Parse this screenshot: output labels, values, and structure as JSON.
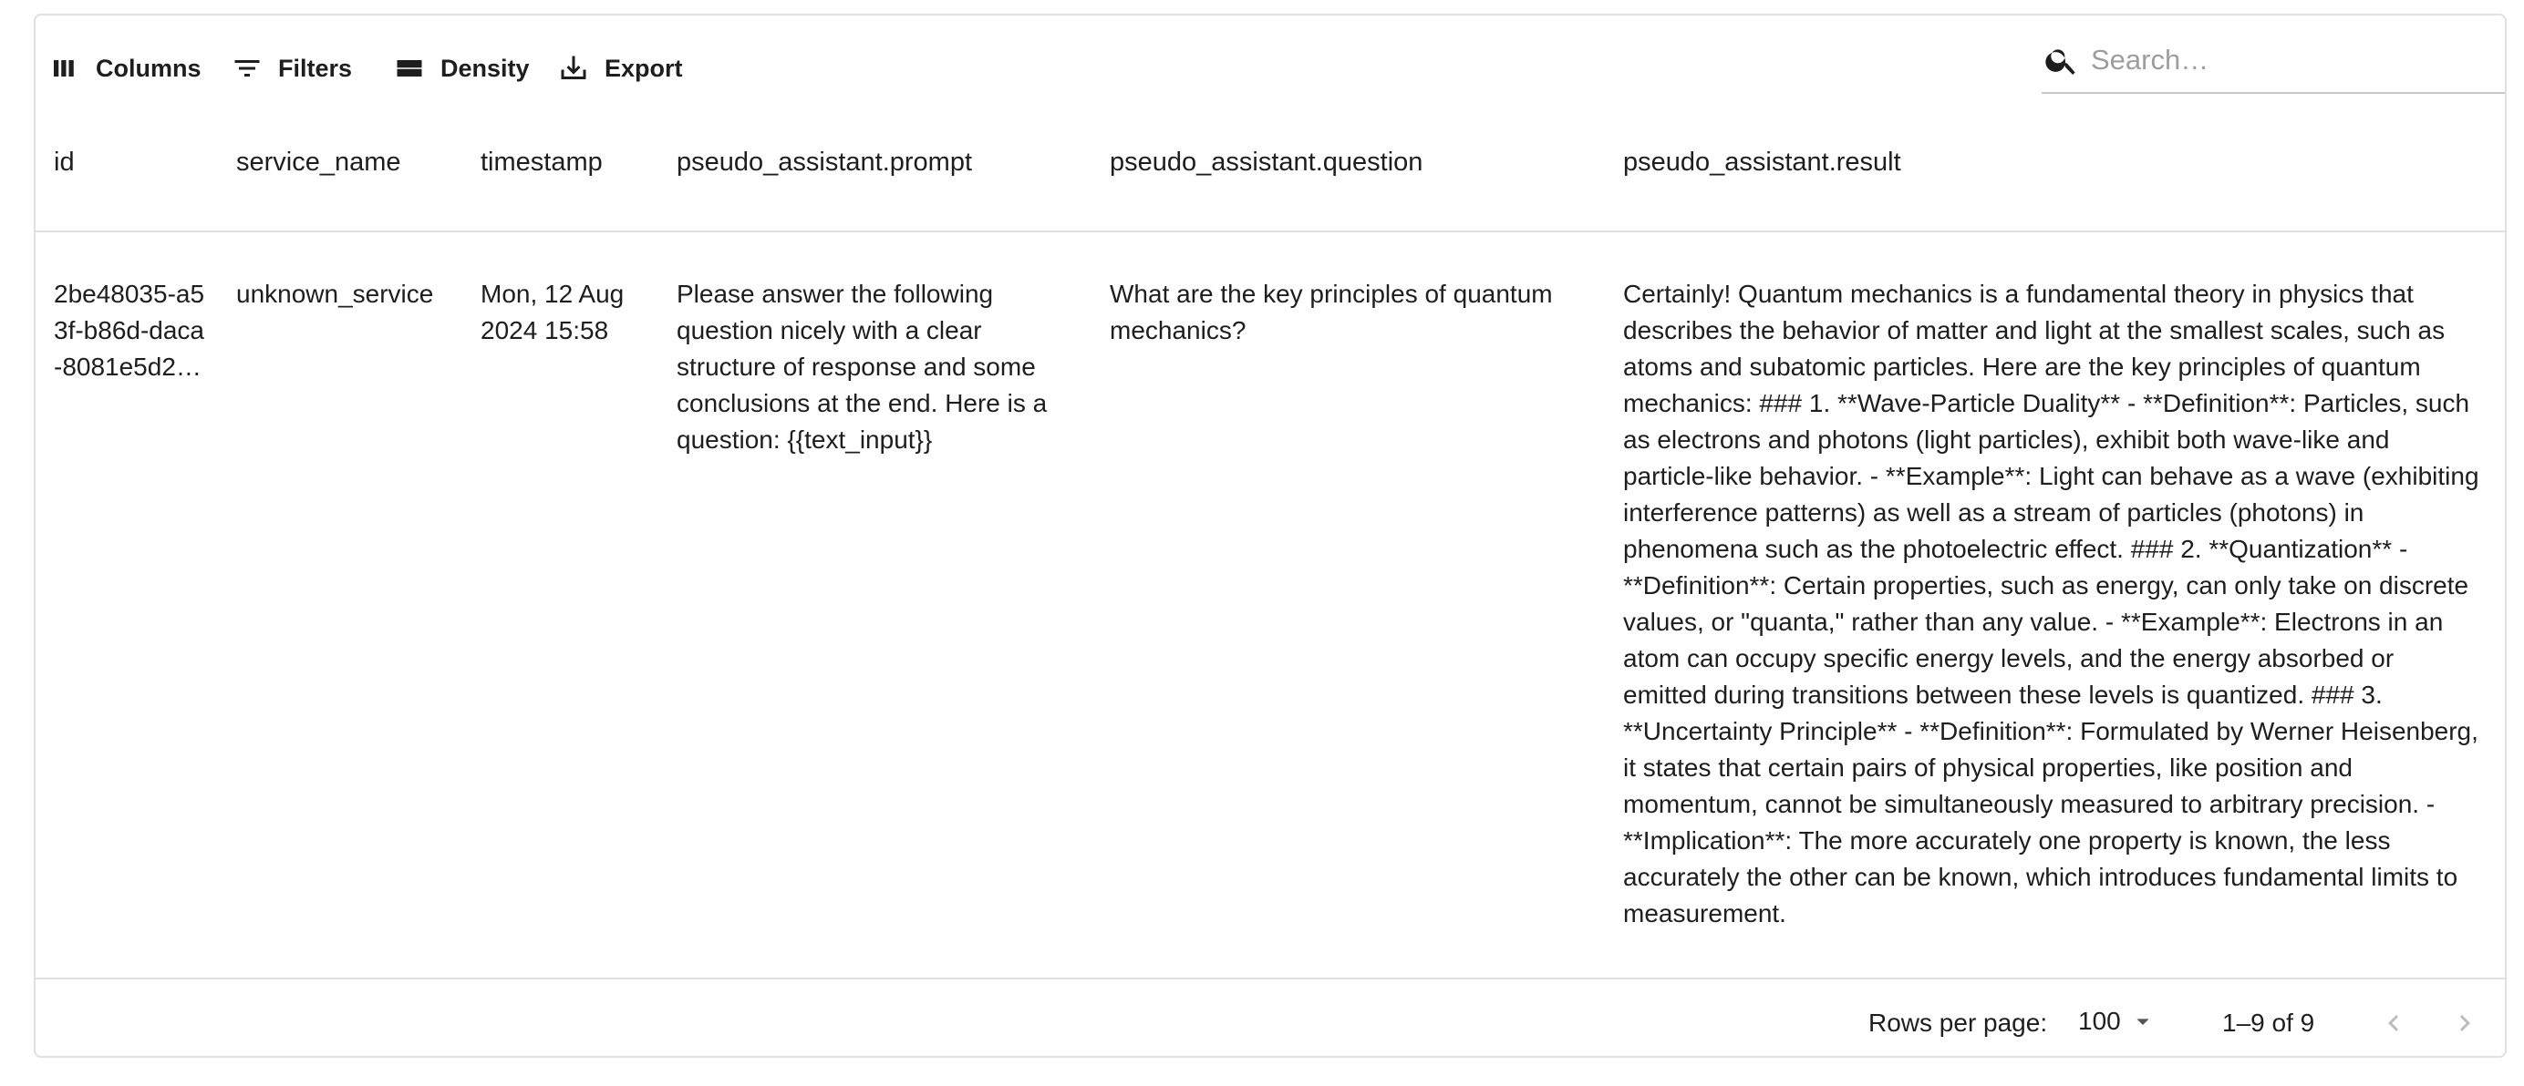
{
  "toolbar": {
    "columns_label": "Columns",
    "filters_label": "Filters",
    "density_label": "Density",
    "export_label": "Export",
    "search_placeholder": "Search…"
  },
  "columns": [
    "id",
    "service_name",
    "timestamp",
    "pseudo_assistant.prompt",
    "pseudo_assistant.question",
    "pseudo_assistant.result"
  ],
  "rows": [
    {
      "id": "2be48035-a53f-b86d-daca-8081e5d2…",
      "service_name": "unknown_service",
      "timestamp": "Mon, 12 Aug 2024 15:58",
      "prompt": "Please answer the following question nicely with a clear structure of response and some conclusions at the end. Here is a question: {{text_input}}",
      "question": "What are the key principles of quantum mechanics?",
      "result": "Certainly! Quantum mechanics is a fundamental theory in physics that describes the behavior of matter and light at the smallest scales, such as atoms and subatomic particles. Here are the key principles of quantum mechanics: ### 1. **Wave-Particle Duality** - **Definition**: Particles, such as electrons and photons (light particles), exhibit both wave-like and particle-like behavior. - **Example**: Light can behave as a wave (exhibiting interference patterns) as well as a stream of particles (photons) in phenomena such as the photoelectric effect. ### 2. **Quantization** - **Definition**: Certain properties, such as energy, can only take on discrete values, or \"quanta,\" rather than any value. - **Example**: Electrons in an atom can occupy specific energy levels, and the energy absorbed or emitted during transitions between these levels is quantized. ### 3. **Uncertainty Principle** - **Definition**: Formulated by Werner Heisenberg, it states that certain pairs of physical properties, like position and momentum, cannot be simultaneously measured to arbitrary precision. - **Implication**: The more accurately one property is known, the less accurately the other can be known, which introduces fundamental limits to measurement."
    }
  ],
  "footer": {
    "rows_per_page_label": "Rows per page:",
    "rows_per_page_value": "100",
    "range_text": "1–9 of 9"
  },
  "icons": {
    "columns": "view-column-icon",
    "filters": "filter-list-icon",
    "density": "density-icon",
    "export": "download-icon",
    "search": "search-icon",
    "select_arrow": "arrow-drop-down-icon",
    "prev": "chevron-left-icon",
    "next": "chevron-right-icon"
  },
  "colors": {
    "text": "#1e1e1e",
    "border": "#e0e0e0",
    "disabled": "#bdbdbd",
    "placeholder": "#9e9e9e"
  }
}
